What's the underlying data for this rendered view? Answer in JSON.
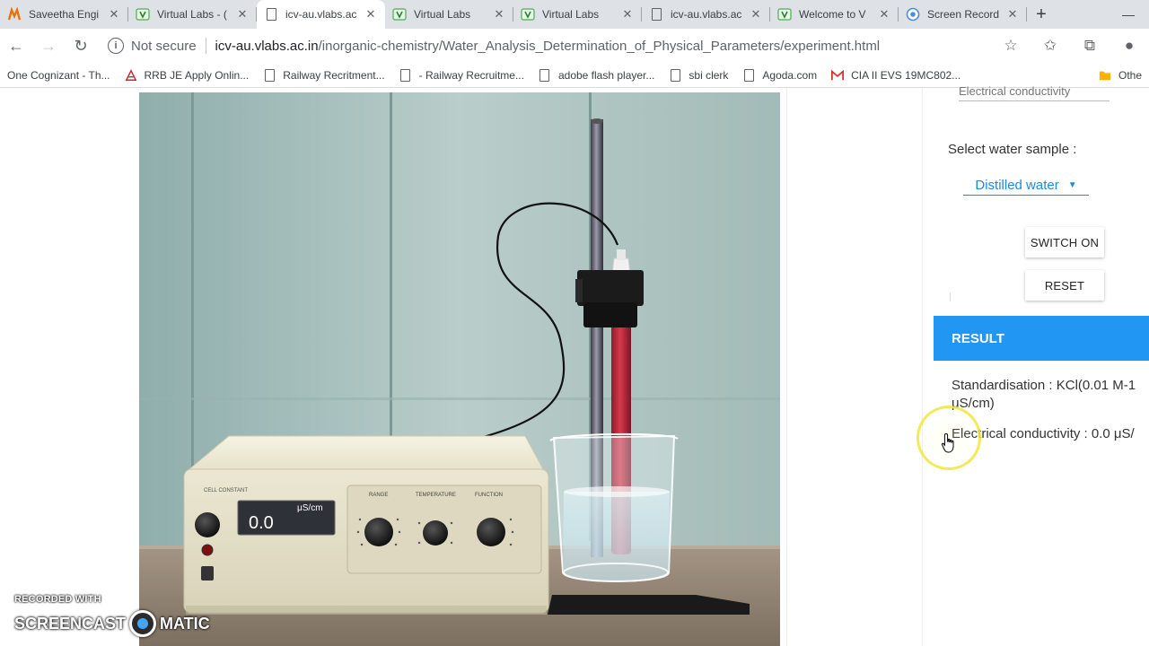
{
  "browser": {
    "tabs": [
      {
        "title": "Saveetha Engi",
        "icon": "saveetha-favicon-icon",
        "active": false
      },
      {
        "title": "Virtual Labs - (",
        "icon": "vlabs-favicon-icon",
        "active": false
      },
      {
        "title": "icv-au.vlabs.ac",
        "icon": "page-icon",
        "active": true
      },
      {
        "title": "Virtual Labs",
        "icon": "vlabs-favicon-icon",
        "active": false
      },
      {
        "title": "Virtual Labs",
        "icon": "vlabs-favicon-icon",
        "active": false
      },
      {
        "title": "icv-au.vlabs.ac",
        "icon": "page-icon",
        "active": false
      },
      {
        "title": "Welcome to V",
        "icon": "vlabs-favicon-icon",
        "active": false
      },
      {
        "title": "Screen Record",
        "icon": "screencast-favicon-icon",
        "active": false
      }
    ],
    "new_tab": "+",
    "security": "Not secure",
    "url_host": "icv-au.vlabs.ac.in",
    "url_path": "/inorganic-chemistry/Water_Analysis_Determination_of_Physical_Parameters/experiment.html",
    "bookmarks": [
      {
        "label": "One Cognizant - Th...",
        "icon": "cognizant-icon"
      },
      {
        "label": "RRB JE Apply Onlin...",
        "icon": "rrb-icon"
      },
      {
        "label": "Railway Recritment...",
        "icon": "page-icon"
      },
      {
        "label": "- Railway Recruitme...",
        "icon": "page-icon"
      },
      {
        "label": "adobe flash player...",
        "icon": "page-icon"
      },
      {
        "label": "sbi clerk",
        "icon": "page-icon"
      },
      {
        "label": "Agoda.com",
        "icon": "page-icon"
      },
      {
        "label": "CIA II EVS 19MC802...",
        "icon": "gmail-icon"
      }
    ],
    "other_bookmarks": "Othe"
  },
  "panel": {
    "cut_label": "Electrical conductivity",
    "select_label": "Select water sample :",
    "selected_sample": "Distilled water",
    "switch_on": "SWITCH ON",
    "reset": "RESET",
    "result_header": "RESULT",
    "standardisation_line1": "Standardisation : KCl(0.01 M-1",
    "standardisation_line2": "μS/cm)",
    "conductivity_line": "Electrical conductivity : 0.0 μS/"
  },
  "simulation": {
    "meter_display": "0.0",
    "meter_unit": "μS/cm",
    "label_cell_constant": "CELL CONSTANT",
    "label_range": "RANGE",
    "label_temperature": "TEMPERATURE",
    "label_function": "FUNCTION"
  },
  "watermark": {
    "small": "RECORDED WITH",
    "left": "SCREENCAST",
    "right": "MATIC"
  },
  "colors": {
    "accent_blue": "#2196f3",
    "link_blue": "#1e88e5",
    "probe_red": "#c0283a",
    "cursor_ring": "#f0e63c"
  }
}
